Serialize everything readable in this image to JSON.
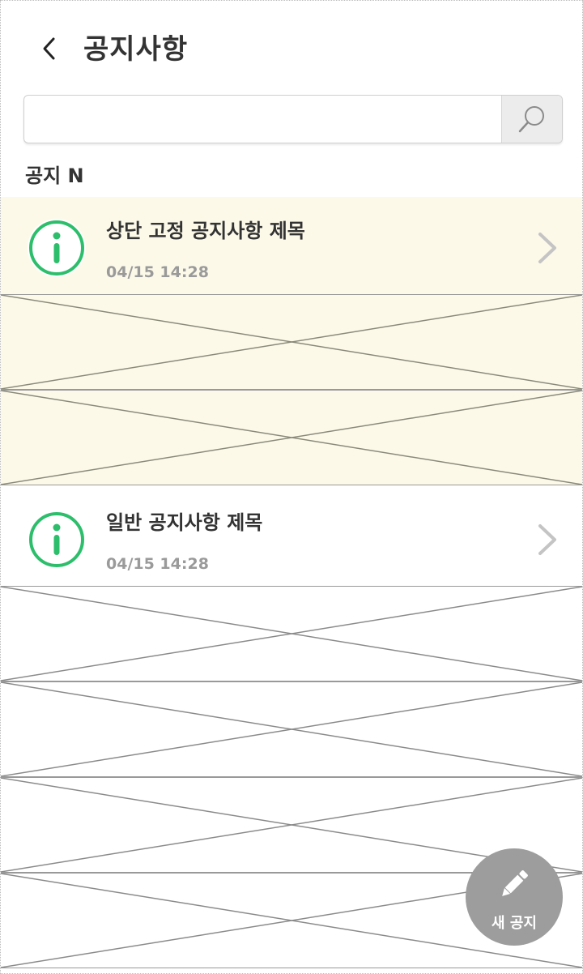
{
  "header": {
    "title": "공지사항"
  },
  "search": {
    "value": "",
    "placeholder": ""
  },
  "section": {
    "label": "공지 N"
  },
  "notices": [
    {
      "title": "상단 고정 공지사항 제목",
      "date": "04/15 14:28",
      "pinned": true
    },
    {
      "title": "일반 공지사항 제목",
      "date": "04/15 14:28",
      "pinned": false
    }
  ],
  "fab": {
    "label": "새 공지"
  },
  "colors": {
    "accent_green": "#2dbe6c",
    "pinned_background": "#fcf9e9",
    "fab_background": "#9d9d9d"
  },
  "icons": [
    "back-arrow-icon",
    "search-icon",
    "info-icon",
    "chevron-right-icon",
    "pencil-icon"
  ]
}
